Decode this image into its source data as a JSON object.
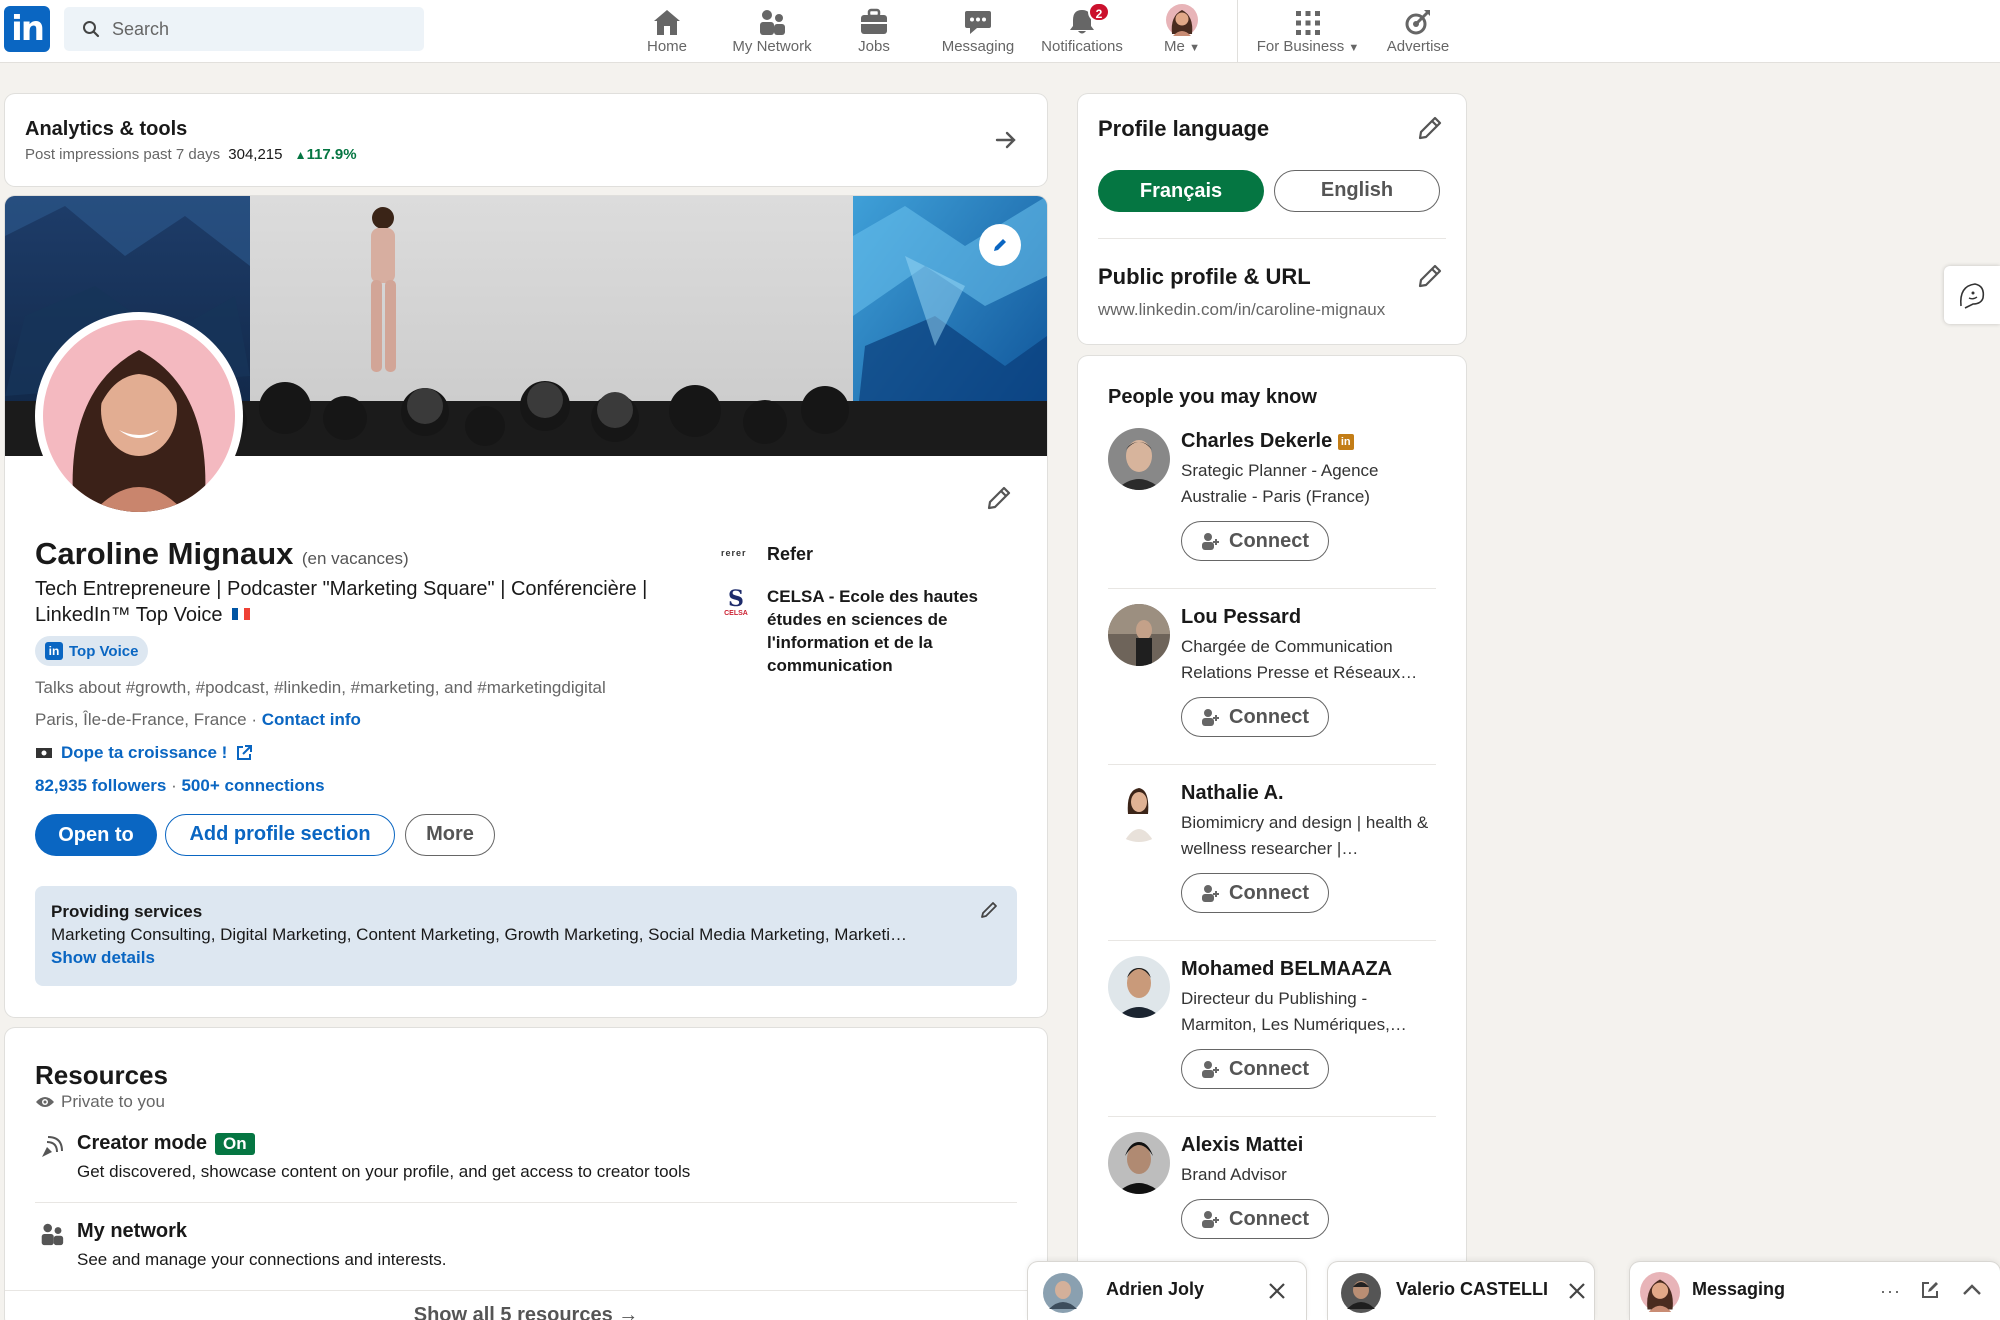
{
  "nav": {
    "logo": "in",
    "search_placeholder": "Search",
    "items": [
      {
        "label": "Home",
        "icon": "home-icon"
      },
      {
        "label": "My Network",
        "icon": "network-icon"
      },
      {
        "label": "Jobs",
        "icon": "briefcase-icon"
      },
      {
        "label": "Messaging",
        "icon": "chat-icon"
      },
      {
        "label": "Notifications",
        "icon": "bell-icon",
        "badge": "2"
      },
      {
        "label": "Me",
        "icon": "avatar"
      },
      {
        "label": "For Business",
        "icon": "grid-icon"
      },
      {
        "label": "Advertise",
        "icon": "advertise-icon"
      }
    ]
  },
  "analytics": {
    "title": "Analytics & tools",
    "impressions_label": "Post impressions past 7 days",
    "impressions_value": "304,215",
    "change": "117.9%"
  },
  "profile": {
    "name": "Caroline Mignaux",
    "status": "(en vacances)",
    "headline": "Tech Entrepreneure | Podcaster \"Marketing Square\" | Conférencière | LinkedIn™ Top Voice",
    "top_voice": "Top Voice",
    "talks_about": "Talks about #growth, #podcast, #linkedin, #marketing, and #marketingdigital",
    "location": "Paris, Île-de-France, France",
    "contact_info": "Contact info",
    "website": "Dope ta croissance !",
    "followers": "82,935 followers",
    "connections": "500+ connections",
    "buttons": {
      "open_to": "Open to",
      "add_section": "Add profile section",
      "more": "More"
    },
    "company_logo_text": "rerer",
    "company": "Refer",
    "school": "CELSA - Ecole des hautes études en sciences de l'information et de la communication",
    "school_logo_text": "CELSA",
    "services_title": "Providing services",
    "services_list": "Marketing Consulting, Digital Marketing, Content Marketing, Growth Marketing, Social Media Marketing, Marketi…",
    "services_link": "Show details"
  },
  "resources": {
    "title": "Resources",
    "private": "Private to you",
    "items": [
      {
        "title": "Creator mode",
        "badge": "On",
        "desc": "Get discovered, showcase content on your profile, and get access to creator tools"
      },
      {
        "title": "My network",
        "desc": "See and manage your connections and interests."
      }
    ],
    "show_all": "Show all 5 resources →"
  },
  "language": {
    "title": "Profile language",
    "options": [
      "Français",
      "English"
    ],
    "selected": "Français",
    "public_title": "Public profile & URL",
    "url": "www.linkedin.com/in/caroline-mignaux"
  },
  "pymk": {
    "title": "People you may know",
    "connect_label": "Connect",
    "people": [
      {
        "name": "Charles Dekerle",
        "desc": "Srategic Planner - Agence Australie - Paris (France)"
      },
      {
        "name": "Lou Pessard",
        "desc": "Chargée de Communication Relations Presse et Réseaux…"
      },
      {
        "name": "Nathalie A.",
        "desc": "Biomimicry and design | health & wellness researcher |…"
      },
      {
        "name": "Mohamed BELMAAZA",
        "desc": "Directeur du Publishing - Marmiton, Les Numériques,…"
      },
      {
        "name": "Alexis Mattei",
        "desc": "Brand Advisor"
      }
    ]
  },
  "messaging": {
    "chats": [
      {
        "name": "Adrien Joly"
      },
      {
        "name": "Valerio CASTELLI"
      }
    ],
    "overlay_title": "Messaging"
  },
  "colors": {
    "brand": "#0a66c2",
    "green": "#057642",
    "badge_red": "#cb112d"
  }
}
